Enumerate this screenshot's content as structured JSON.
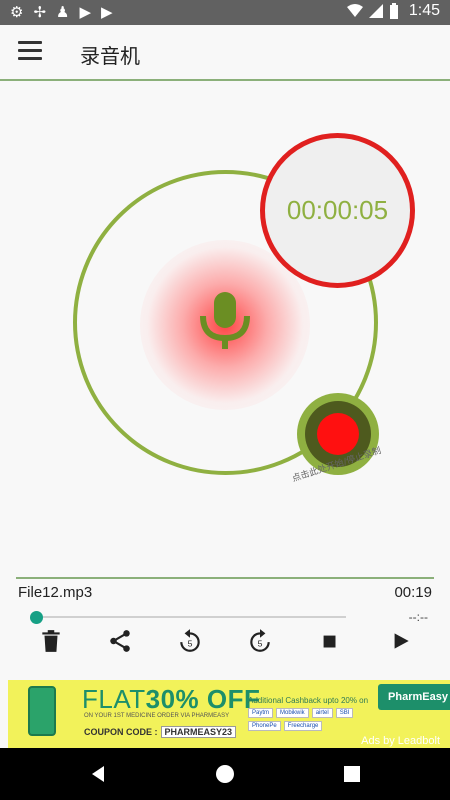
{
  "status_bar": {
    "time": "1:45",
    "left_icons": [
      "settings-icon",
      "share-icon",
      "notification-icon",
      "play-store-icon",
      "play-store-icon"
    ],
    "right_icons": [
      "wifi-icon",
      "signal-icon",
      "battery-icon"
    ]
  },
  "app_bar": {
    "title": "录音机"
  },
  "recorder": {
    "timer": "00:00:05",
    "hint": "点击此处开始/停止录制",
    "colors": {
      "ring": "#8fb041",
      "timer_border": "#e0201f",
      "record_dot": "#ff1010"
    }
  },
  "player": {
    "file_name": "File12.mp3",
    "duration": "00:19",
    "position": "--:--",
    "progress": 0.0,
    "controls": [
      "delete-icon",
      "share-icon",
      "rewind-5-icon",
      "forward-5-icon",
      "stop-icon",
      "play-icon"
    ],
    "accent": "#16a085"
  },
  "ad": {
    "headline_light": "FLAT",
    "headline_bold": "30% OFF",
    "sub": "ON YOUR 1ST MEDICINE ORDER VIA PHARMEASY",
    "coupon_label": "COUPON CODE :",
    "coupon_code": "PHARMEASY23",
    "cashback": "Additional Cashback upto 20% on",
    "wallets": [
      "Paytm",
      "Mobikwik",
      "airtel",
      "SBI",
      "PhonePe",
      "Freecharge"
    ],
    "brand": "PharmEasy",
    "attribution": "Ads by Leadbolt"
  },
  "nav_bar": {
    "buttons": [
      "back-icon",
      "home-icon",
      "recents-icon"
    ]
  }
}
